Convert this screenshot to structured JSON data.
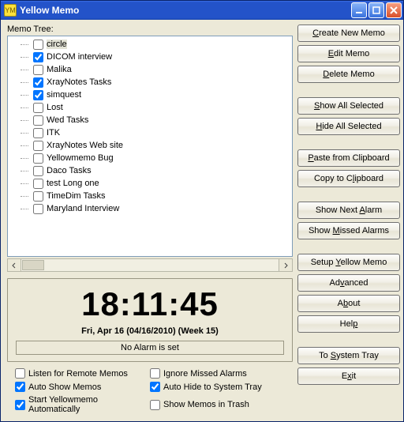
{
  "window": {
    "title": "Yellow Memo"
  },
  "tree": {
    "label": "Memo Tree:",
    "items": [
      {
        "label": "circle",
        "checked": false,
        "selected": true
      },
      {
        "label": "DICOM interview",
        "checked": true
      },
      {
        "label": "Malika",
        "checked": false
      },
      {
        "label": "XrayNotes Tasks",
        "checked": true
      },
      {
        "label": "simquest",
        "checked": true
      },
      {
        "label": "Lost",
        "checked": false
      },
      {
        "label": "Wed Tasks",
        "checked": false
      },
      {
        "label": "ITK",
        "checked": false
      },
      {
        "label": "XrayNotes Web site",
        "checked": false
      },
      {
        "label": "Yellowmemo Bug",
        "checked": false
      },
      {
        "label": "Daco Tasks",
        "checked": false
      },
      {
        "label": "test Long one",
        "checked": false
      },
      {
        "label": "TimeDim Tasks",
        "checked": false
      },
      {
        "label": "Maryland Interview",
        "checked": false
      }
    ]
  },
  "clock": {
    "time": "18:11:45",
    "date": "Fri, Apr 16 (04/16/2010) (Week 15)",
    "alarm_status": "No Alarm is set"
  },
  "options": {
    "listen_remote": {
      "label": "Listen for Remote Memos",
      "checked": false
    },
    "ignore_missed": {
      "label": "Ignore Missed Alarms",
      "checked": false
    },
    "auto_show": {
      "label": "Auto Show Memos",
      "checked": true
    },
    "auto_hide": {
      "label": "Auto Hide to System Tray",
      "checked": true
    },
    "start_auto": {
      "label": "Start Yellowmemo Automatically",
      "checked": true
    },
    "show_trash": {
      "label": "Show Memos in Trash",
      "checked": false
    }
  },
  "buttons": {
    "create": "Create New Memo",
    "edit": "Edit Memo",
    "delete": "Delete Memo",
    "show_sel": "Show All Selected",
    "hide_sel": "Hide All Selected",
    "paste": "Paste from Clipboard",
    "copy": "Copy to Clipboard",
    "next_alarm": "Show Next Alarm",
    "missed_alarms": "Show Missed Alarms",
    "setup": "Setup Yellow Memo",
    "advanced": "Advanced",
    "about": "About",
    "help": "Help",
    "to_tray": "To System Tray",
    "exit": "Exit"
  },
  "button_mnemonics": {
    "create": "C",
    "edit": "E",
    "delete": "D",
    "show_sel": "S",
    "hide_sel": "H",
    "paste": "P",
    "copy": "l",
    "next_alarm": "A",
    "missed_alarms": "M",
    "setup": "Y",
    "advanced": "v",
    "about": "b",
    "help": "p",
    "to_tray": "S",
    "exit": "x"
  }
}
